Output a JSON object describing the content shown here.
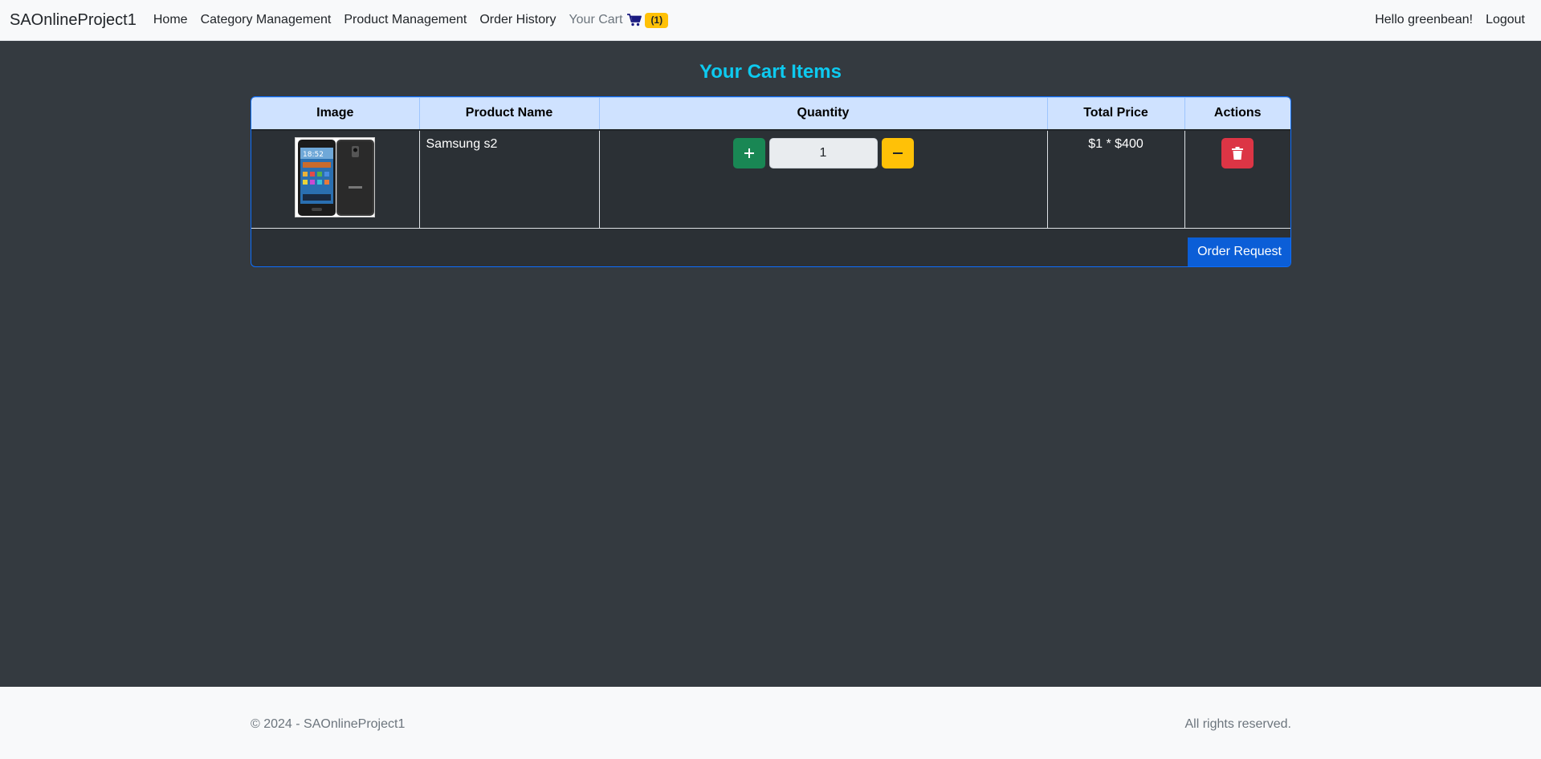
{
  "navbar": {
    "brand": "SAOnlineProject1",
    "links": {
      "home": "Home",
      "category": "Category Management",
      "product": "Product Management",
      "orders": "Order History",
      "cart": "Your Cart"
    },
    "cart_count": "(1)",
    "greeting": "Hello greenbean!",
    "logout": "Logout"
  },
  "page": {
    "title": "Your Cart Items"
  },
  "cart": {
    "columns": {
      "image": "Image",
      "name": "Product Name",
      "quantity": "Quantity",
      "total": "Total Price",
      "actions": "Actions"
    },
    "items": [
      {
        "name": "Samsung s2",
        "quantity": "1",
        "total": "$1 * $400"
      }
    ],
    "order_button": "Order Request"
  },
  "footer": {
    "copyright": "© 2024 - SAOnlineProject1",
    "rights": "All rights reserved."
  },
  "icons": {
    "cart": "cart-icon",
    "plus": "plus-icon",
    "minus": "minus-icon",
    "delete": "trash-icon"
  },
  "colors": {
    "title": "#0dcaf0",
    "success": "#198754",
    "warning": "#ffc107",
    "danger": "#dc3545",
    "primary": "#0b5ed7",
    "header_bg": "#cfe2ff",
    "body_bg": "#343a40"
  }
}
